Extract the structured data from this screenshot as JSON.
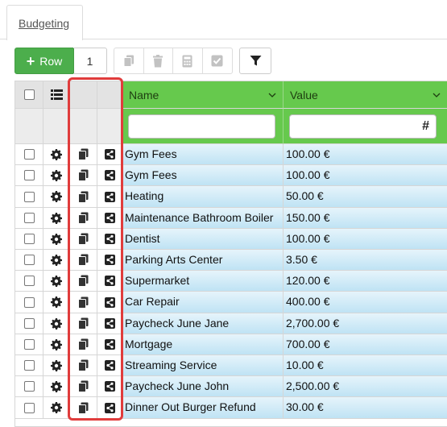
{
  "tab": {
    "label": "Budgeting"
  },
  "toolbar": {
    "add_row_label": "Row",
    "row_count": "1",
    "buttons": [
      "copy-icon",
      "trash-icon",
      "calculator-icon",
      "check-icon"
    ],
    "filter_icon": "filter-icon"
  },
  "grid": {
    "columns": [
      {
        "label": "Name"
      },
      {
        "label": "Value"
      }
    ],
    "filter": {
      "value_symbol": "#"
    },
    "row_icons": [
      "gear-icon",
      "copy-icon",
      "share-icon"
    ],
    "rows": [
      {
        "name": "Gym Fees",
        "value": "100.00 €"
      },
      {
        "name": "Gym Fees",
        "value": "100.00 €"
      },
      {
        "name": "Heating",
        "value": "50.00 €"
      },
      {
        "name": "Maintenance Bathroom Boiler",
        "value": "150.00 €"
      },
      {
        "name": "Dentist",
        "value": "100.00 €"
      },
      {
        "name": "Parking Arts Center",
        "value": "3.50 €"
      },
      {
        "name": "Supermarket",
        "value": "120.00 €"
      },
      {
        "name": "Car Repair",
        "value": "400.00 €"
      },
      {
        "name": "Paycheck June Jane",
        "value": "2,700.00 €"
      },
      {
        "name": "Mortgage",
        "value": "700.00 €"
      },
      {
        "name": "Streaming Service",
        "value": "10.00 €"
      },
      {
        "name": "Paycheck June John",
        "value": "2,500.00 €"
      },
      {
        "name": "Dinner Out Burger Refund",
        "value": "30.00 €"
      }
    ]
  },
  "colors": {
    "accent_green": "#66c94d",
    "add_button": "#4cae4c",
    "row_blue": "#bfe3f4",
    "highlight": "#e03c3c"
  }
}
